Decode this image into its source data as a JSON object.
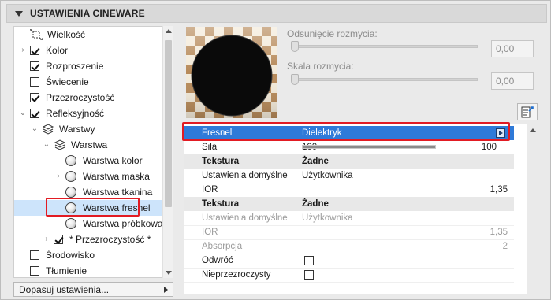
{
  "header": {
    "title": "USTAWIENIA CINEWARE"
  },
  "tree": {
    "items": [
      {
        "label": "Wielkość",
        "type": "size-icon",
        "indent": 0,
        "expander": ""
      },
      {
        "label": "Kolor",
        "type": "checkbox",
        "checked": true,
        "indent": 0,
        "expander": "collapsed"
      },
      {
        "label": "Rozproszenie",
        "type": "checkbox",
        "checked": true,
        "indent": 0,
        "expander": ""
      },
      {
        "label": "Świecenie",
        "type": "checkbox",
        "checked": false,
        "indent": 0,
        "expander": ""
      },
      {
        "label": "Przezroczystość",
        "type": "checkbox",
        "checked": true,
        "indent": 0,
        "expander": ""
      },
      {
        "label": "Refleksyjność",
        "type": "checkbox",
        "checked": true,
        "indent": 0,
        "expander": "expanded"
      },
      {
        "label": "Warstwy",
        "type": "layers-icon",
        "indent": 1,
        "expander": "expanded"
      },
      {
        "label": "Warstwa",
        "type": "layers-icon",
        "indent": 2,
        "expander": "expanded"
      },
      {
        "label": "Warstwa kolor",
        "type": "material-ball",
        "indent": 3,
        "expander": ""
      },
      {
        "label": "Warstwa maska",
        "type": "material-ball",
        "indent": 3,
        "expander": "collapsed"
      },
      {
        "label": "Warstwa tkanina",
        "type": "material-ball",
        "indent": 3,
        "expander": ""
      },
      {
        "label": "Warstwa fresnel",
        "type": "material-ball",
        "indent": 3,
        "expander": "",
        "selected": true
      },
      {
        "label": "Warstwa próbkowanie",
        "type": "material-ball",
        "indent": 3,
        "expander": ""
      },
      {
        "label": "* Przezroczystość *",
        "type": "checkbox",
        "checked": true,
        "indent": 2,
        "expander": "collapsed"
      },
      {
        "label": "Środowisko",
        "type": "checkbox",
        "checked": false,
        "indent": 0,
        "expander": ""
      },
      {
        "label": "Tłumienie",
        "type": "checkbox",
        "checked": false,
        "indent": 0,
        "expander": ""
      }
    ]
  },
  "footer": {
    "dopasuj_label": "Dopasuj ustawienia..."
  },
  "blur": {
    "offset_label": "Odsunięcie rozmycia:",
    "offset_value": "0,00",
    "scale_label": "Skala rozmycia:",
    "scale_value": "0,00"
  },
  "table": {
    "rows": [
      {
        "kind": "selected",
        "name": "Fresnel",
        "value": "Dielektryk"
      },
      {
        "kind": "progress",
        "name": "Siła",
        "value": "100",
        "fraction": 1.0
      },
      {
        "kind": "header",
        "name": "Tekstura",
        "value": "Żadne"
      },
      {
        "kind": "normal",
        "name": "Ustawienia domyślne",
        "value": "Użytkownika"
      },
      {
        "kind": "normal",
        "name": "IOR",
        "num": "1,35"
      },
      {
        "kind": "header",
        "name": "Tekstura",
        "value": "Żadne"
      },
      {
        "kind": "dim",
        "name": "Ustawienia domyślne",
        "value": "Użytkownika"
      },
      {
        "kind": "dim",
        "name": "IOR",
        "num": "1,35"
      },
      {
        "kind": "dim",
        "name": "Absorpcja",
        "num": "2"
      },
      {
        "kind": "checkbox",
        "name": "Odwróć",
        "checked": false
      },
      {
        "kind": "checkbox",
        "name": "Nieprzezroczysty",
        "checked": false
      }
    ]
  },
  "colors": {
    "selection_blue": "#2f7ad8",
    "highlight_red": "#e21b23",
    "tree_selection": "#cde4fb"
  }
}
